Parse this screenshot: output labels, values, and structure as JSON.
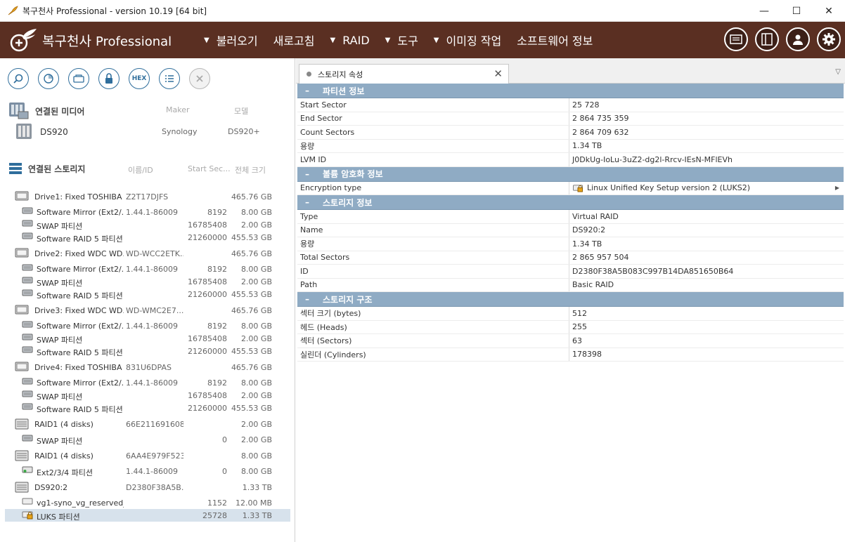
{
  "window": {
    "title": "복구천사 Professional - version 10.19 [64 bit]",
    "minimize": "—",
    "maximize": "☐",
    "close": "✕"
  },
  "brand": {
    "name": "복구천사",
    "suffix": "Professional"
  },
  "menu": [
    {
      "label": "불러오기",
      "caret": true
    },
    {
      "label": "새로고침",
      "caret": false
    },
    {
      "label": "RAID",
      "caret": true
    },
    {
      "label": "도구",
      "caret": true
    },
    {
      "label": "이미징 작업",
      "caret": true
    },
    {
      "label": "소프트웨어 정보",
      "caret": false
    }
  ],
  "toolbar": {
    "hex_label": "HEX"
  },
  "media": {
    "heading": "연결된 미디어",
    "col_maker": "Maker",
    "col_model": "모델",
    "device": {
      "name": "DS920",
      "maker": "Synology",
      "model": "DS920+"
    }
  },
  "storage": {
    "heading": "연결된 스토리지",
    "col_name": "이름/ID",
    "col_start": "Start Sec...",
    "col_size": "전체 크기",
    "rows": [
      {
        "label": "Drive1: Fixed TOSHIBA ...",
        "id": "Z2T17DJFS",
        "start": "",
        "size": "465.76 GB",
        "level": 0,
        "icon": "drive"
      },
      {
        "label": "Software Mirror (Ext2/...",
        "id": "1.44.1-86009",
        "start": "8192",
        "size": "8.00 GB",
        "level": 1,
        "icon": "part"
      },
      {
        "label": "SWAP 파티션",
        "id": "",
        "start": "16785408",
        "size": "2.00 GB",
        "level": 1,
        "icon": "part"
      },
      {
        "label": "Software RAID 5 파티션",
        "id": "",
        "start": "21260000",
        "size": "455.53 GB",
        "level": 1,
        "icon": "part"
      },
      {
        "label": "Drive2: Fixed WDC WD...",
        "id": "WD-WCC2ETK...",
        "start": "",
        "size": "465.76 GB",
        "level": 0,
        "icon": "drive"
      },
      {
        "label": "Software Mirror (Ext2/...",
        "id": "1.44.1-86009",
        "start": "8192",
        "size": "8.00 GB",
        "level": 1,
        "icon": "part"
      },
      {
        "label": "SWAP 파티션",
        "id": "",
        "start": "16785408",
        "size": "2.00 GB",
        "level": 1,
        "icon": "part"
      },
      {
        "label": "Software RAID 5 파티션",
        "id": "",
        "start": "21260000",
        "size": "455.53 GB",
        "level": 1,
        "icon": "part"
      },
      {
        "label": "Drive3: Fixed WDC WD...",
        "id": "WD-WMC2E7...",
        "start": "",
        "size": "465.76 GB",
        "level": 0,
        "icon": "drive"
      },
      {
        "label": "Software Mirror (Ext2/...",
        "id": "1.44.1-86009",
        "start": "8192",
        "size": "8.00 GB",
        "level": 1,
        "icon": "part"
      },
      {
        "label": "SWAP 파티션",
        "id": "",
        "start": "16785408",
        "size": "2.00 GB",
        "level": 1,
        "icon": "part"
      },
      {
        "label": "Software RAID 5 파티션",
        "id": "",
        "start": "21260000",
        "size": "455.53 GB",
        "level": 1,
        "icon": "part"
      },
      {
        "label": "Drive4: Fixed TOSHIBA ...",
        "id": "831U6DPAS",
        "start": "",
        "size": "465.76 GB",
        "level": 0,
        "icon": "drive"
      },
      {
        "label": "Software Mirror (Ext2/...",
        "id": "1.44.1-86009",
        "start": "8192",
        "size": "8.00 GB",
        "level": 1,
        "icon": "part"
      },
      {
        "label": "SWAP 파티션",
        "id": "",
        "start": "16785408",
        "size": "2.00 GB",
        "level": 1,
        "icon": "part"
      },
      {
        "label": "Software RAID 5 파티션",
        "id": "",
        "start": "21260000",
        "size": "455.53 GB",
        "level": 1,
        "icon": "part"
      },
      {
        "label": "RAID1 (4 disks)",
        "id": "66E211691608...",
        "start": "",
        "size": "2.00 GB",
        "level": 0,
        "icon": "raid"
      },
      {
        "label": "SWAP 파티션",
        "id": "",
        "start": "0",
        "size": "2.00 GB",
        "level": 1,
        "icon": "part"
      },
      {
        "label": "RAID1 (4 disks)",
        "id": "6AA4E979F523...",
        "start": "",
        "size": "8.00 GB",
        "level": 0,
        "icon": "raid"
      },
      {
        "label": "Ext2/3/4 파티션",
        "id": "1.44.1-86009",
        "start": "0",
        "size": "8.00 GB",
        "level": 1,
        "icon": "partg"
      },
      {
        "label": "DS920:2",
        "id": "D2380F38A5B...",
        "start": "",
        "size": "1.33 TB",
        "level": 0,
        "icon": "raid"
      },
      {
        "label": "vg1-syno_vg_reserved_...",
        "id": "",
        "start": "1152",
        "size": "12.00 MB",
        "level": 1,
        "icon": "partw"
      },
      {
        "label": "LUKS 파티션",
        "id": "",
        "start": "25728",
        "size": "1.33 TB",
        "level": 1,
        "icon": "lock",
        "selected": true
      }
    ]
  },
  "tab": {
    "label": "스토리지 속성"
  },
  "properties": [
    {
      "title": "파티션 정보",
      "rows": [
        {
          "k": "Start Sector",
          "v": "25 728"
        },
        {
          "k": "End Sector",
          "v": "2 864 735 359"
        },
        {
          "k": "Count Sectors",
          "v": "2 864 709 632"
        },
        {
          "k": "용량",
          "v": "1.34 TB"
        },
        {
          "k": "LVM ID",
          "v": "J0DkUg-IoLu-3uZ2-dg2l-Rrcv-IEsN-MFlEVh"
        }
      ]
    },
    {
      "title": "볼륨 암호화 정보",
      "rows": [
        {
          "k": "Encryption type",
          "v": "Linux Unified Key Setup version 2 (LUKS2)",
          "lock": true,
          "arrow": true
        }
      ]
    },
    {
      "title": "스토리지 정보",
      "rows": [
        {
          "k": "Type",
          "v": "Virtual RAID"
        },
        {
          "k": "Name",
          "v": "DS920:2"
        },
        {
          "k": "용량",
          "v": "1.34 TB"
        },
        {
          "k": "Total Sectors",
          "v": "2 865 957 504"
        },
        {
          "k": "ID",
          "v": "D2380F38A5B083C997B14DA851650B64"
        },
        {
          "k": "Path",
          "v": "Basic RAID"
        }
      ]
    },
    {
      "title": "스토리지 구조",
      "rows": [
        {
          "k": "섹터 크기 (bytes)",
          "v": "512"
        },
        {
          "k": "헤드 (Heads)",
          "v": "255"
        },
        {
          "k": "섹터 (Sectors)",
          "v": "63"
        },
        {
          "k": "실린더 (Cylinders)",
          "v": "178398"
        }
      ]
    }
  ]
}
